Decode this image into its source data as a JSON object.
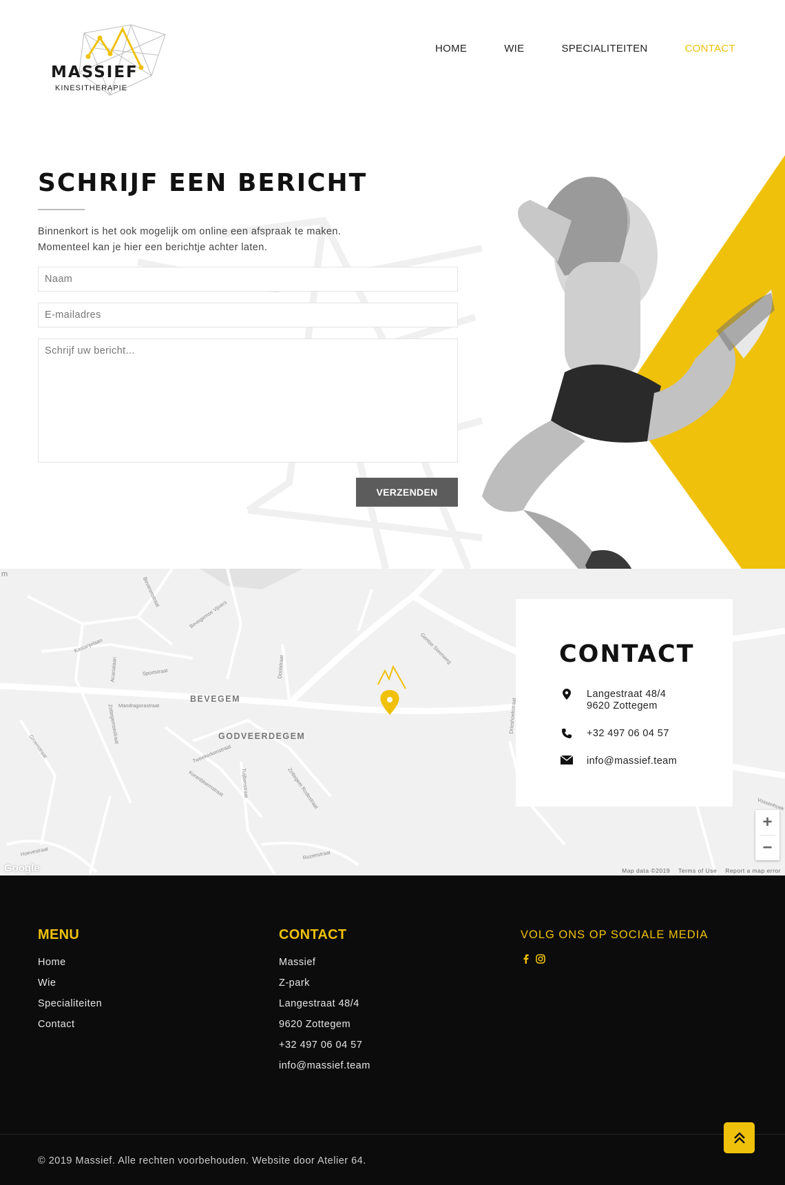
{
  "brand": {
    "name": "MASSIEF",
    "subtitle": "KINESITHERAPIE",
    "accent": "#f0c10b"
  },
  "nav": {
    "items": [
      {
        "label": "HOME"
      },
      {
        "label": "WIE"
      },
      {
        "label": "SPECIALITEITEN"
      },
      {
        "label": "CONTACT",
        "active": true
      }
    ]
  },
  "form": {
    "title": "SCHRIJF EEN BERICHT",
    "desc_line1": "Binnenkort is het ook mogelijk om online een afspraak te maken.",
    "desc_line2": "Momenteel kan je hier een berichtje achter laten.",
    "name_placeholder": "Naam",
    "email_placeholder": "E-mailadres",
    "message_placeholder": "Schrijf uw bericht...",
    "submit_label": "VERZENDEN"
  },
  "map": {
    "places": [
      "BEVEGEM",
      "GODVEERDEGEM"
    ],
    "streets": [
      "Gentse Steenweg",
      "Kastanjelaan",
      "Beverenstraat",
      "Acacialaan",
      "Sportstraat",
      "Bevegemse Vijvers",
      "Mandragorastraat",
      "Zottegemsestraat",
      "Tweekerkenstraat",
      "Korenbloemstraat",
      "Tuijbenstraat",
      "Zottegem Rodestraat",
      "Groenstraat",
      "Hoevestraat",
      "Rozenstraat",
      "Drieshoekstraat",
      "Doolstraat",
      "Vossenhoek"
    ],
    "google": "Google",
    "map_data": "Map data ©2019",
    "terms": "Terms of Use",
    "report": "Report a map error",
    "zoom_in": "+",
    "zoom_out": "−",
    "edge_label": "m"
  },
  "contact_card": {
    "title": "CONTACT",
    "address_line1": "Langestraat 48/4",
    "address_line2": "9620 Zottegem",
    "phone": "+32 497 06 04 57",
    "email": "info@massief.team"
  },
  "footer": {
    "menu_title": "MENU",
    "menu_items": [
      "Home",
      "Wie",
      "Specialiteiten",
      "Contact"
    ],
    "contact_title": "CONTACT",
    "contact_items": [
      "Massief",
      "Z-park",
      "Langestraat 48/4",
      "9620 Zottegem",
      "+32 497 06 04 57",
      "info@massief.team"
    ],
    "social_title": "VOLG ONS OP SOCIALE MEDIA",
    "social_icons": [
      "facebook-icon",
      "instagram-icon"
    ],
    "copyright": "© 2019 Massief. Alle rechten voorbehouden. Website door Atelier 64."
  }
}
